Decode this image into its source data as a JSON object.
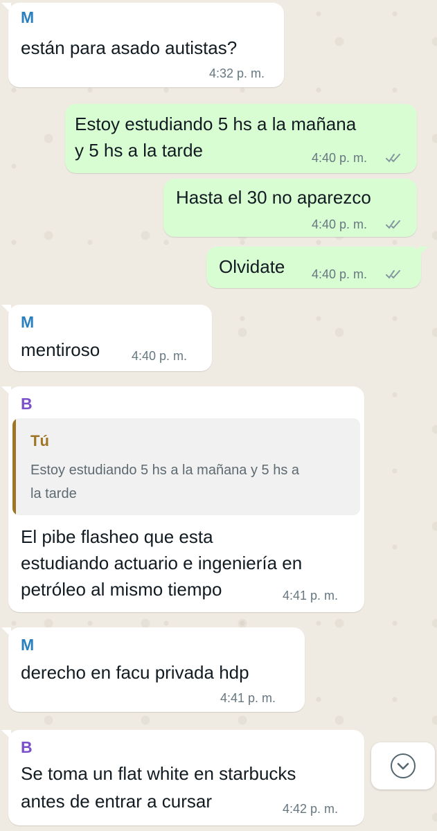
{
  "colors": {
    "sender_m": "#2a7fbf",
    "sender_b": "#7b4fc9",
    "quote_author": "#a07426",
    "ticks": "#8696a0"
  },
  "messages": [
    {
      "sender": "M",
      "lines": [
        "están para asado autistas?"
      ],
      "time": "4:32 p. m."
    },
    {
      "lines": [
        "Estoy estudiando 5 hs a la mañana",
        "y 5 hs a la tarde"
      ],
      "time": "4:40 p. m.",
      "status_icon": "double-check-icon"
    },
    {
      "lines": [
        "Hasta el 30 no aparezco"
      ],
      "time": "4:40 p. m.",
      "status_icon": "double-check-icon"
    },
    {
      "lines": [
        "Olvidate"
      ],
      "time": "4:40 p. m.",
      "status_icon": "double-check-icon"
    },
    {
      "sender": "M",
      "lines": [
        "mentiroso"
      ],
      "time": "4:40 p. m."
    },
    {
      "sender": "B",
      "quote": {
        "author": "Tú",
        "lines": [
          "Estoy estudiando 5 hs a la mañana y 5 hs a",
          "la tarde"
        ]
      },
      "lines": [
        "El pibe flasheo que esta",
        "estudiando actuario e ingeniería en",
        "petróleo al mismo tiempo"
      ],
      "time": "4:41 p. m."
    },
    {
      "sender": "M",
      "lines": [
        "derecho en facu privada hdp"
      ],
      "time": "4:41 p. m."
    },
    {
      "sender": "B",
      "lines": [
        "Se toma un flat white en starbucks",
        "antes de entrar a cursar"
      ],
      "time": "4:42 p. m."
    }
  ],
  "scroll_button": {
    "icon": "chevron-down-icon"
  }
}
